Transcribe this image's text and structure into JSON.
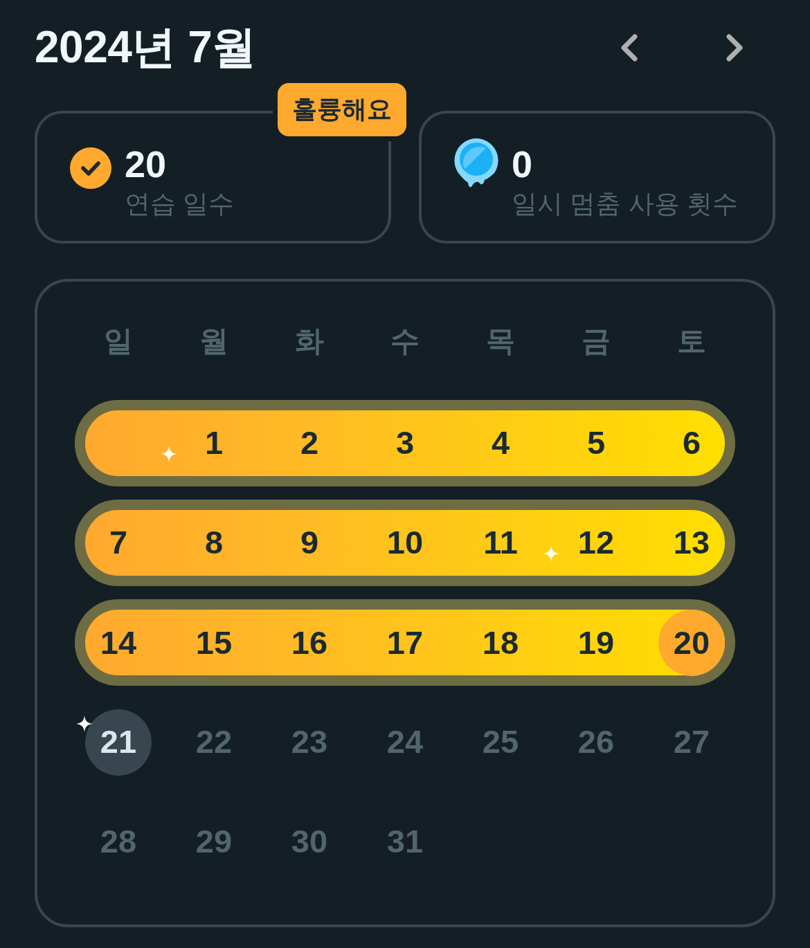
{
  "header": {
    "title": "2024년 7월"
  },
  "stats": [
    {
      "kind": "streak",
      "value": "20",
      "label": "연습 일수",
      "badge": "훌륭해요"
    },
    {
      "kind": "freeze",
      "value": "0",
      "label": "일시 멈춤 사용 횟수"
    }
  ],
  "calendar": {
    "weekdays": [
      "일",
      "월",
      "화",
      "수",
      "목",
      "금",
      "토"
    ],
    "weeks": [
      {
        "streak": true,
        "days": [
          {
            "kind": "blank"
          },
          {
            "kind": "streak",
            "day": "1",
            "sparkle": true
          },
          {
            "kind": "streak",
            "day": "2",
            "sparkle": false
          },
          {
            "kind": "streak",
            "day": "3",
            "sparkle": false
          },
          {
            "kind": "streak",
            "day": "4",
            "sparkle": false
          },
          {
            "kind": "streak",
            "day": "5",
            "sparkle": false
          },
          {
            "kind": "streak",
            "day": "6",
            "sparkle": false
          }
        ]
      },
      {
        "streak": true,
        "days": [
          {
            "kind": "streak",
            "day": "7",
            "sparkle": false
          },
          {
            "kind": "streak",
            "day": "8",
            "sparkle": false
          },
          {
            "kind": "streak",
            "day": "9",
            "sparkle": false
          },
          {
            "kind": "streak",
            "day": "10",
            "sparkle": false
          },
          {
            "kind": "streak",
            "day": "11",
            "sparkle": false
          },
          {
            "kind": "streak",
            "day": "12",
            "sparkle": true
          },
          {
            "kind": "streak",
            "day": "13",
            "sparkle": false
          }
        ]
      },
      {
        "streak": true,
        "days": [
          {
            "kind": "streak",
            "day": "14",
            "sparkle": false
          },
          {
            "kind": "streak",
            "day": "15",
            "sparkle": false
          },
          {
            "kind": "streak",
            "day": "16",
            "sparkle": false
          },
          {
            "kind": "streak",
            "day": "17",
            "sparkle": false
          },
          {
            "kind": "streak",
            "day": "18",
            "sparkle": false
          },
          {
            "kind": "streak",
            "day": "19",
            "sparkle": false
          },
          {
            "kind": "streak-end",
            "day": "20",
            "sparkle": false
          }
        ]
      },
      {
        "streak": false,
        "days": [
          {
            "kind": "today",
            "day": "21",
            "sparkle": true
          },
          {
            "kind": "future",
            "day": "22",
            "sparkle": false
          },
          {
            "kind": "future",
            "day": "23",
            "sparkle": false
          },
          {
            "kind": "future",
            "day": "24",
            "sparkle": false
          },
          {
            "kind": "future",
            "day": "25",
            "sparkle": false
          },
          {
            "kind": "future",
            "day": "26",
            "sparkle": false
          },
          {
            "kind": "future",
            "day": "27",
            "sparkle": false
          }
        ]
      },
      {
        "streak": false,
        "days": [
          {
            "kind": "future",
            "day": "28",
            "sparkle": false
          },
          {
            "kind": "future",
            "day": "29",
            "sparkle": false
          },
          {
            "kind": "future",
            "day": "30",
            "sparkle": false
          },
          {
            "kind": "future",
            "day": "31",
            "sparkle": false
          }
        ]
      }
    ]
  }
}
